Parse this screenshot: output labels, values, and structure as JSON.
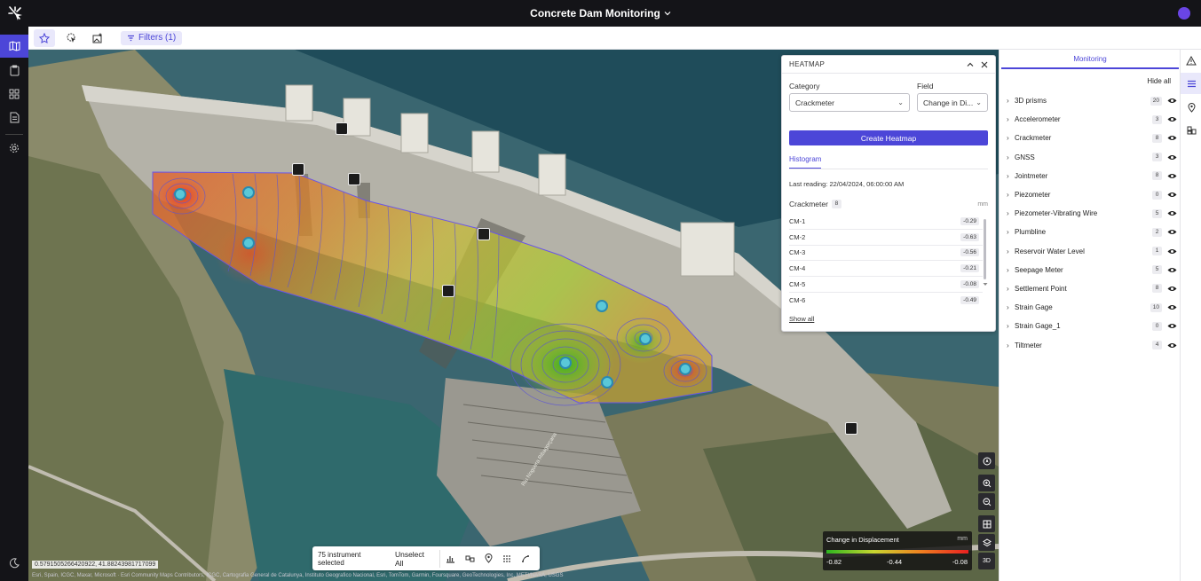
{
  "app": {
    "title": "Concrete Dam Monitoring"
  },
  "toolbar": {
    "filters_label": "Filters (1)"
  },
  "heatmap": {
    "title": "HEATMAP",
    "category_label": "Category",
    "category_value": "Crackmeter",
    "field_label": "Field",
    "field_value": "Change in Di...",
    "create_label": "Create Heatmap",
    "tab_label": "Histogram",
    "last_reading": "Last reading: 22/04/2024, 06:00:00 AM",
    "group_name": "Crackmeter",
    "group_count": "8",
    "unit": "mm",
    "readings": [
      {
        "name": "CM-1",
        "value": "-0.29"
      },
      {
        "name": "CM-2",
        "value": "-0.63"
      },
      {
        "name": "CM-3",
        "value": "-0.56"
      },
      {
        "name": "CM-4",
        "value": "-0.21"
      },
      {
        "name": "CM-5",
        "value": "-0.08"
      },
      {
        "name": "CM-6",
        "value": "-0.49"
      }
    ],
    "show_all": "Show all"
  },
  "map": {
    "coords": "0.5791505266420922, 41.88243981717099",
    "attribution": "Esri, Spain, ICGC, Maxar, Microsoft · Esri Community Maps Contributors, ICGC, Cartografia General de Catalunya, Instituto Geografico Nacional, Esri, TomTom, Garmin, Foursquare, GeoTechnologies, Inc, METI/NASA, USGS",
    "road_label": "Riu Noguera Ribagorçana"
  },
  "selection": {
    "count_label": "75 instrument selected",
    "unselect_label": "Unselect All"
  },
  "legend": {
    "title": "Change in Displacement",
    "unit": "mm",
    "min": "-0.82",
    "mid": "-0.44",
    "max": "-0.08"
  },
  "map_controls": {
    "three_d": "3D"
  },
  "right_panel": {
    "tab": "Monitoring",
    "hide_all": "Hide all",
    "categories": [
      {
        "name": "3D prisms",
        "count": "20"
      },
      {
        "name": "Accelerometer",
        "count": "3"
      },
      {
        "name": "Crackmeter",
        "count": "8"
      },
      {
        "name": "GNSS",
        "count": "3"
      },
      {
        "name": "Jointmeter",
        "count": "8"
      },
      {
        "name": "Piezometer",
        "count": "0"
      },
      {
        "name": "Piezometer-Vibrating Wire",
        "count": "5"
      },
      {
        "name": "Plumbline",
        "count": "2"
      },
      {
        "name": "Reservoir Water Level",
        "count": "1"
      },
      {
        "name": "Seepage Meter",
        "count": "5"
      },
      {
        "name": "Settlement Point",
        "count": "8"
      },
      {
        "name": "Strain Gage",
        "count": "10"
      },
      {
        "name": "Strain Gage_1",
        "count": "0"
      },
      {
        "name": "Tiltmeter",
        "count": "4"
      }
    ]
  },
  "colors": {
    "accent": "#4c46d8",
    "topbar": "#141418",
    "heat_low": "#2db520",
    "heat_high": "#e82020"
  }
}
